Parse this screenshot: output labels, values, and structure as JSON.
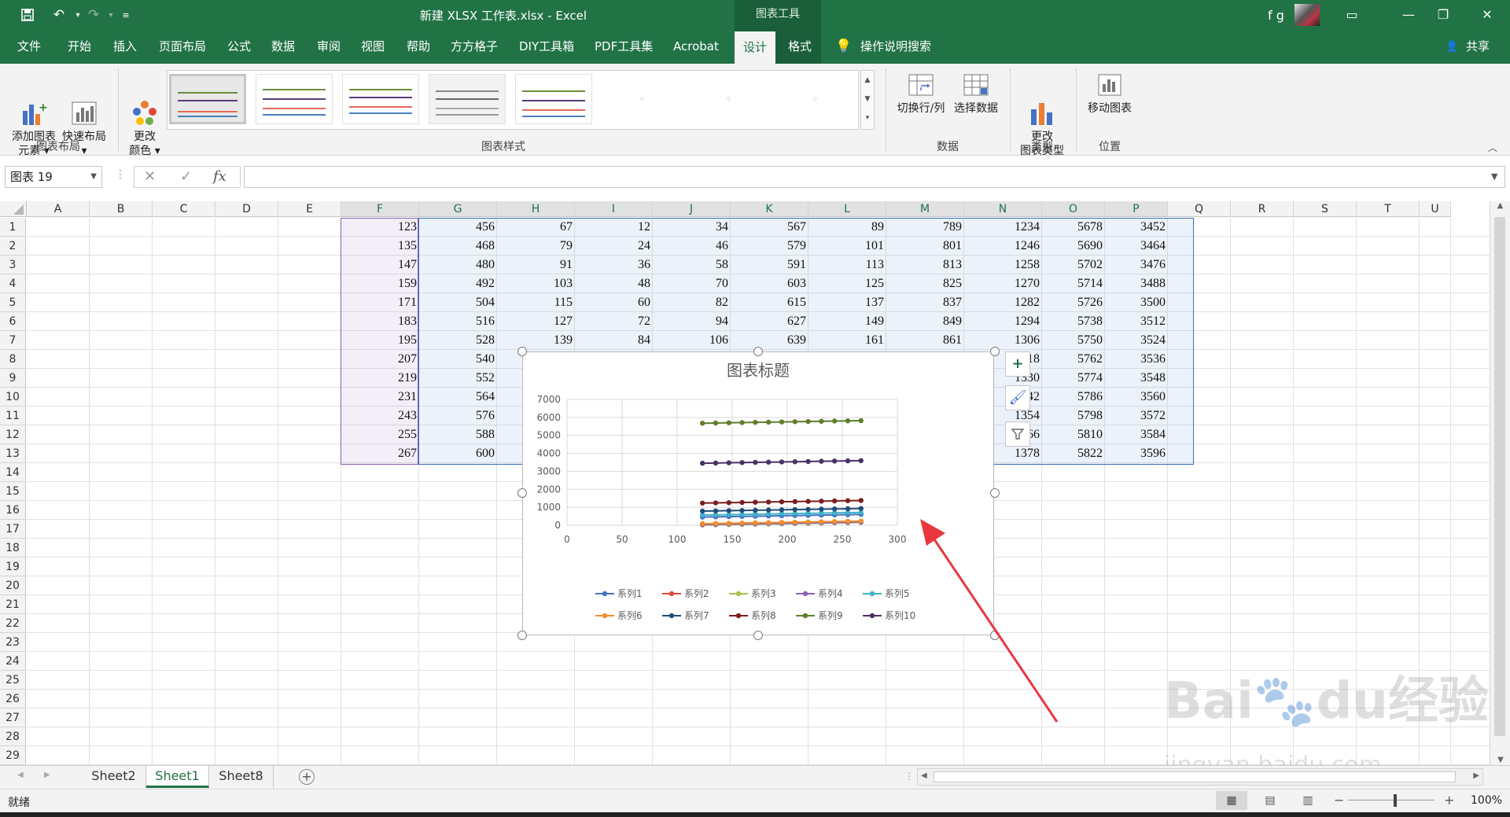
{
  "window": {
    "title": "新建 XLSX 工作表.xlsx  -  Excel",
    "context_tab": "图表工具",
    "user_name": "f g"
  },
  "menu": {
    "tabs": [
      "文件",
      "开始",
      "插入",
      "页面布局",
      "公式",
      "数据",
      "审阅",
      "视图",
      "帮助",
      "方方格子",
      "DIY工具箱",
      "PDF工具集",
      "Acrobat",
      "设计",
      "格式"
    ],
    "active_tab": "设计",
    "tell_me": "操作说明搜索",
    "share": "共享"
  },
  "ribbon": {
    "add_chart_element": "添加图表\n元素 ▾",
    "quick_layout": "快速布局\n▾",
    "change_colors": "更改\n颜色 ▾",
    "switch_row_col": "切换行/列",
    "select_data": "选择数据",
    "change_chart_type": "更改\n图表类型",
    "move_chart": "移动图表",
    "groups": {
      "chart_layout": "图表布局",
      "chart_styles": "图表样式",
      "data": "数据",
      "type": "类型",
      "location": "位置"
    }
  },
  "formula_bar": {
    "name_box": "图表 19",
    "fx": "fx",
    "formula": ""
  },
  "columns": [
    "A",
    "B",
    "C",
    "D",
    "E",
    "F",
    "G",
    "H",
    "I",
    "J",
    "K",
    "L",
    "M",
    "N",
    "O",
    "P",
    "Q",
    "R",
    "S",
    "T",
    "U"
  ],
  "rows": [
    "1",
    "2",
    "3",
    "4",
    "5",
    "6",
    "7",
    "8",
    "9",
    "10",
    "11",
    "12",
    "13",
    "14",
    "15",
    "16",
    "17",
    "18",
    "19",
    "20",
    "21",
    "22",
    "23",
    "24",
    "25",
    "26",
    "27",
    "28",
    "29"
  ],
  "table": {
    "F": [
      "123",
      "135",
      "147",
      "159",
      "171",
      "183",
      "195",
      "207",
      "219",
      "231",
      "243",
      "255",
      "267"
    ],
    "G": [
      "456",
      "468",
      "480",
      "492",
      "504",
      "516",
      "528",
      "540",
      "552",
      "564",
      "576",
      "588",
      "600"
    ],
    "H": [
      "67",
      "79",
      "91",
      "103",
      "115",
      "127",
      "139",
      "",
      "",
      "",
      "",
      "",
      ""
    ],
    "I": [
      "12",
      "24",
      "36",
      "48",
      "60",
      "72",
      "84",
      "",
      "",
      "",
      "",
      "",
      ""
    ],
    "J": [
      "34",
      "46",
      "58",
      "70",
      "82",
      "94",
      "106",
      "",
      "",
      "",
      "",
      "",
      ""
    ],
    "K": [
      "567",
      "579",
      "591",
      "603",
      "615",
      "627",
      "639",
      "",
      "",
      "",
      "",
      "",
      ""
    ],
    "L": [
      "89",
      "101",
      "113",
      "125",
      "137",
      "149",
      "161",
      "",
      "",
      "",
      "",
      "",
      ""
    ],
    "M": [
      "789",
      "801",
      "813",
      "825",
      "837",
      "849",
      "861",
      "",
      "",
      "",
      "",
      "",
      ""
    ],
    "N": [
      "1234",
      "1246",
      "1258",
      "1270",
      "1282",
      "1294",
      "1306",
      "18",
      "1330",
      "42",
      "1354",
      "66",
      "1378"
    ],
    "O": [
      "5678",
      "5690",
      "5702",
      "5714",
      "5726",
      "5738",
      "5750",
      "5762",
      "5774",
      "5786",
      "5798",
      "5810",
      "5822"
    ],
    "P": [
      "3452",
      "3464",
      "3476",
      "3488",
      "3500",
      "3512",
      "3524",
      "3536",
      "3548",
      "3560",
      "3572",
      "3584",
      "3596"
    ]
  },
  "sheets": [
    "Sheet2",
    "Sheet1",
    "Sheet8"
  ],
  "active_sheet": "Sheet1",
  "status": {
    "ready": "就绪",
    "zoom": "100%"
  },
  "watermark": "Baidu经验 jingyan.baidu.com",
  "colors": {
    "excel_green": "#217346",
    "series": [
      "#4472c4",
      "#e0463a",
      "#a5c24a",
      "#8a5fb5",
      "#3fb0c8",
      "#f28e2b",
      "#1f4e79",
      "#7b1e1e",
      "#5f7f2a",
      "#4b3266"
    ],
    "arrow": "#e8383d"
  },
  "chart_data": {
    "type": "scatter",
    "title": "图表标题",
    "xlim": [
      0,
      300
    ],
    "ylim": [
      0,
      7000
    ],
    "x_ticks": [
      "0",
      "50",
      "100",
      "150",
      "200",
      "250",
      "300"
    ],
    "y_ticks": [
      "0",
      "1000",
      "2000",
      "3000",
      "4000",
      "5000",
      "6000",
      "7000"
    ],
    "x": [
      123,
      135,
      147,
      159,
      171,
      183,
      195,
      207,
      219,
      231,
      243,
      255,
      267
    ],
    "series": [
      {
        "name": "系列1",
        "values": [
          456,
          468,
          480,
          492,
          504,
          516,
          528,
          540,
          552,
          564,
          576,
          588,
          600
        ]
      },
      {
        "name": "系列2",
        "values": [
          67,
          79,
          91,
          103,
          115,
          127,
          139,
          151,
          163,
          175,
          187,
          199,
          211
        ]
      },
      {
        "name": "系列3",
        "values": [
          12,
          24,
          36,
          48,
          60,
          72,
          84,
          96,
          108,
          120,
          132,
          144,
          156
        ]
      },
      {
        "name": "系列4",
        "values": [
          34,
          46,
          58,
          70,
          82,
          94,
          106,
          118,
          130,
          142,
          154,
          166,
          178
        ]
      },
      {
        "name": "系列5",
        "values": [
          567,
          579,
          591,
          603,
          615,
          627,
          639,
          651,
          663,
          675,
          687,
          699,
          711
        ]
      },
      {
        "name": "系列6",
        "values": [
          89,
          101,
          113,
          125,
          137,
          149,
          161,
          173,
          185,
          197,
          209,
          221,
          233
        ]
      },
      {
        "name": "系列7",
        "values": [
          789,
          801,
          813,
          825,
          837,
          849,
          861,
          873,
          885,
          897,
          909,
          921,
          933
        ]
      },
      {
        "name": "系列8",
        "values": [
          1234,
          1246,
          1258,
          1270,
          1282,
          1294,
          1306,
          1318,
          1330,
          1342,
          1354,
          1366,
          1378
        ]
      },
      {
        "name": "系列9",
        "values": [
          5678,
          5690,
          5702,
          5714,
          5726,
          5738,
          5750,
          5762,
          5774,
          5786,
          5798,
          5810,
          5822
        ]
      },
      {
        "name": "系列10",
        "values": [
          3452,
          3464,
          3476,
          3488,
          3500,
          3512,
          3524,
          3536,
          3548,
          3560,
          3572,
          3584,
          3596
        ]
      }
    ],
    "legend_position": "bottom",
    "grid": true
  }
}
